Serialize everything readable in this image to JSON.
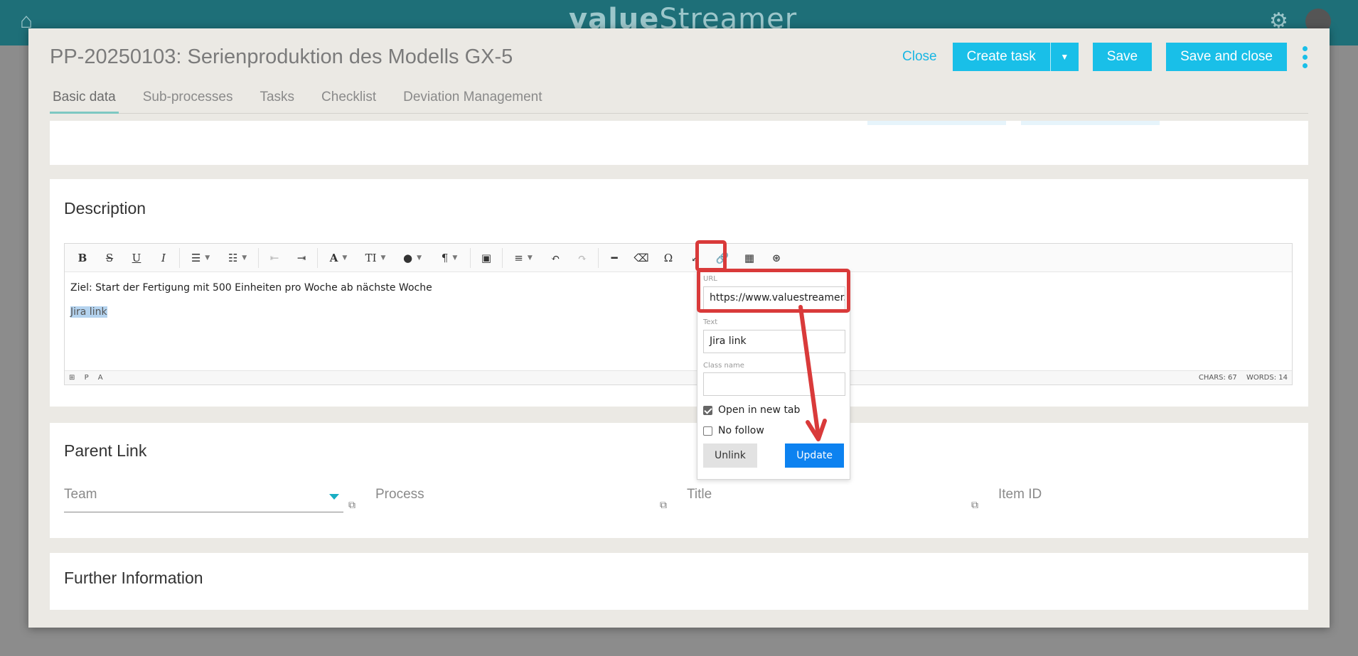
{
  "app": {
    "brand_left": "value",
    "brand_right": "treamer",
    "home_icon": "home-icon",
    "gear_icon": "gear-icon"
  },
  "modal": {
    "title": "PP-20250103: Serienproduktion des Modells GX-5",
    "actions": {
      "close": "Close",
      "create_task": "Create task",
      "save": "Save",
      "save_and_close": "Save and close"
    },
    "tabs": [
      {
        "label": "Basic data",
        "active": true
      },
      {
        "label": "Sub-processes",
        "active": false
      },
      {
        "label": "Tasks",
        "active": false
      },
      {
        "label": "Checklist",
        "active": false
      },
      {
        "label": "Deviation Management",
        "active": false
      }
    ]
  },
  "description": {
    "title": "Description",
    "content": {
      "line1": "Ziel: Start der Fertigung mit 500 Einheiten pro Woche ab nächste Woche",
      "line2": "Jira link"
    },
    "statusbar": {
      "p": "P",
      "a": "A",
      "chars": "CHARS: 67",
      "words": "WORDS: 14"
    }
  },
  "link_popup": {
    "url_label": "URL",
    "url_value": "https://www.valuestreamer.",
    "text_label": "Text",
    "text_value": "Jira link",
    "class_label": "Class name",
    "class_value": "",
    "open_new_tab_label": "Open in new tab",
    "open_new_tab_checked": true,
    "no_follow_label": "No follow",
    "no_follow_checked": false,
    "unlink": "Unlink",
    "update": "Update"
  },
  "parent_link": {
    "title": "Parent Link",
    "team": "Team",
    "process": "Process",
    "title_field": "Title",
    "item_id": "Item ID"
  },
  "further_info": {
    "title": "Further Information"
  },
  "colors": {
    "accent": "#19bfe8",
    "update_button": "#0d82f0",
    "annotation": "#d93a3a",
    "topbar": "#1e6f78"
  }
}
